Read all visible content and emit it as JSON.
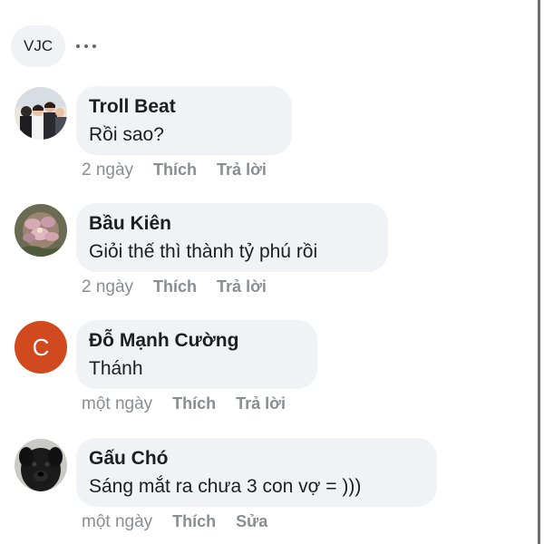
{
  "header": {
    "tag_label": "VJC",
    "more_icon": "more-horizontal-icon"
  },
  "comments": [
    {
      "author": "Troll Beat",
      "text": "Rồi sao?",
      "time": "2 ngày",
      "actions": [
        "Thích",
        "Trả lời"
      ]
    },
    {
      "author": "Bầu Kiên",
      "text": "Giỏi thế thì thành tỷ phú rồi",
      "time": "2 ngày",
      "actions": [
        "Thích",
        "Trả lời"
      ]
    },
    {
      "author": "Đỗ Mạnh Cường",
      "avatar_letter": "C",
      "avatar_color": "#d14a1f",
      "text": "Thánh",
      "time": "một ngày",
      "actions": [
        "Thích",
        "Trả lời"
      ]
    },
    {
      "author": "Gấu Chó",
      "text": "Sáng mắt ra chưa 3 con vợ = )))",
      "time": "một ngày",
      "actions": [
        "Thích",
        "Sửa"
      ]
    }
  ],
  "colors": {
    "bubble": "#f0f2f5",
    "text": "#1c1e21",
    "meta": "#8a8d91"
  }
}
